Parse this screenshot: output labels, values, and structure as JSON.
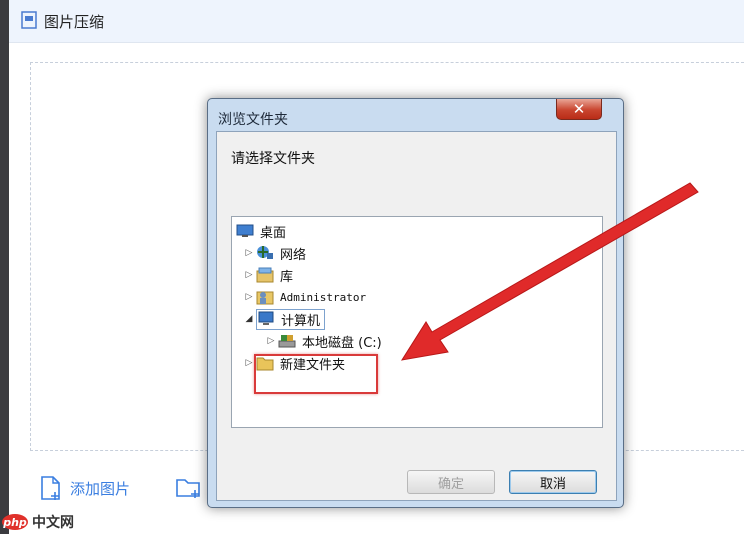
{
  "app": {
    "title": "图片压缩"
  },
  "actions": {
    "add_image_label": "添加图片"
  },
  "watermark": {
    "logo": "php",
    "text": "中文网"
  },
  "dialog": {
    "title": "浏览文件夹",
    "close_glyph": "✕",
    "prompt": "请选择文件夹",
    "tree": [
      {
        "label": "桌面",
        "icon": "desktop-icon"
      },
      {
        "label": "网络",
        "icon": "network-icon"
      },
      {
        "label": "库",
        "icon": "library-icon"
      },
      {
        "label": "Administrator",
        "icon": "user-folder-icon"
      },
      {
        "label": "计算机",
        "icon": "computer-icon"
      },
      {
        "label": "本地磁盘 (C:)",
        "icon": "disk-icon"
      },
      {
        "label": "新建文件夹",
        "icon": "folder-icon"
      }
    ],
    "ok_label": "确定",
    "cancel_label": "取消"
  },
  "colors": {
    "accent": "#3a7ee0",
    "annotation": "#d93a3a",
    "dialog_frame": "#c9dcf0"
  }
}
